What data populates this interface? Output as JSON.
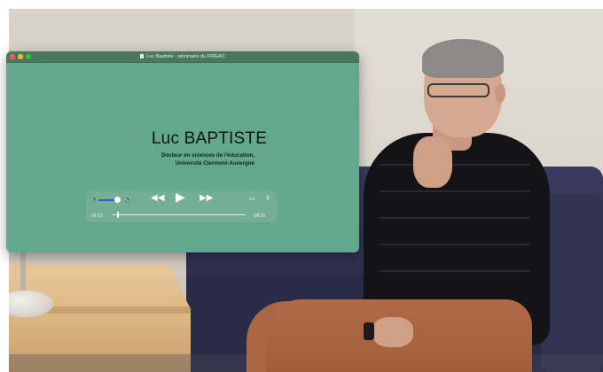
{
  "window": {
    "title": "Luc Baptiste - séminaire du FIREAC"
  },
  "slide": {
    "name": "Luc BAPTISTE",
    "subtitle_line1": "Docteur en sciences de l'éducation,",
    "subtitle_line2": "Université Clermont-Auvergne"
  },
  "player": {
    "volume_level": 0.75,
    "current_time": "00:13",
    "remaining_time": "-08:15",
    "progress": 0.03,
    "icons": {
      "volume_low": "speaker-low-icon",
      "volume_high": "speaker-high-icon",
      "rewind": "rewind-icon",
      "play": "play-icon",
      "fast_forward": "fast-forward-icon",
      "airplay": "airplay-icon",
      "share": "share-icon"
    }
  }
}
